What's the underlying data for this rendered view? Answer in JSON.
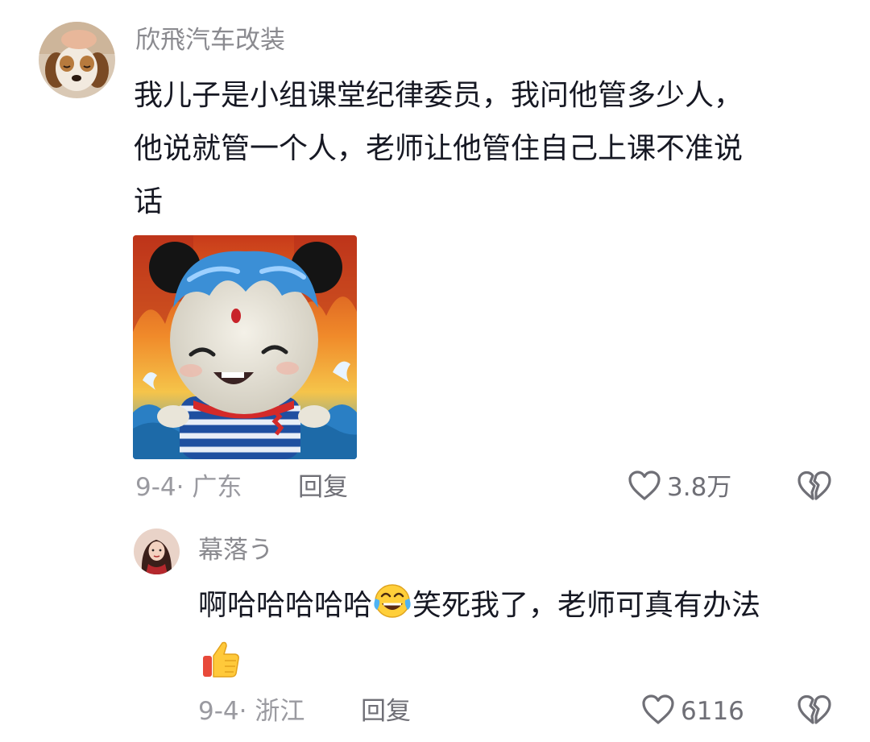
{
  "comment1": {
    "username": "欣飛汽车改装",
    "text_line1": "我儿子是小组课堂纪律委员，我问他管多少人，",
    "text_line2": "他说就管一个人，老师让他管住自己上课不准说",
    "text_line3": "话",
    "date_location": "9-4· 广东",
    "reply_label": "回复",
    "like_count": "3.8万"
  },
  "reply1": {
    "username": "幕落う",
    "text_part1": "啊哈哈哈哈哈",
    "text_part2": "笑死我了，老师可真有办法",
    "date_location": "9-4· 浙江",
    "reply_label": "回复",
    "like_count": "6116"
  },
  "icons": {
    "like": "heart-outline-icon",
    "dislike": "broken-heart-icon",
    "laugh_emoji": "tears-of-joy-emoji",
    "thumbs_emoji": "thumbs-up-emoji"
  }
}
